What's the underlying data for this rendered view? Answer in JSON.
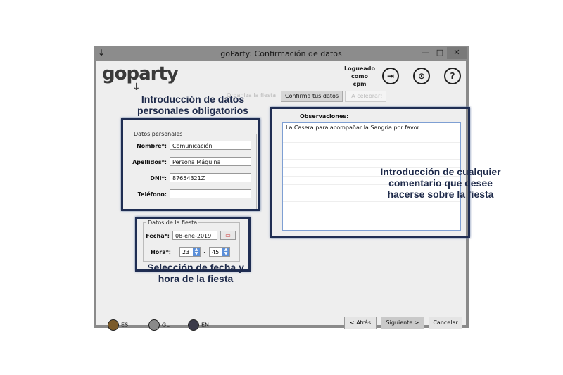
{
  "window": {
    "title": "goParty: Confirmación de datos",
    "menu_icon": "↓",
    "min": "—",
    "max": "□",
    "close": "✕"
  },
  "app": {
    "logo": "goparty",
    "logo_arrow": "↓"
  },
  "user": {
    "line1": "Logueado",
    "line2": "como",
    "line3": "cpm"
  },
  "header_icons": {
    "logout": "⇥",
    "cart": "⊙",
    "help": "?"
  },
  "tabs": [
    {
      "label": "Organiza la fiesta"
    },
    {
      "label": "Confirma tus datos"
    },
    {
      "label": "¡A celebrar!"
    }
  ],
  "datos_personales": {
    "legend": "Datos personales",
    "nombre_label": "Nombre*:",
    "nombre_value": "Comunicación",
    "apellidos_label": "Apellidos*:",
    "apellidos_value": "Persona Máquina",
    "dni_label": "DNI*:",
    "dni_value": "87654321Z",
    "telefono_label": "Teléfono:",
    "telefono_value": ""
  },
  "datos_fiesta": {
    "legend": "Datos de la fiesta",
    "fecha_label": "Fecha*:",
    "fecha_value": "08-ene-2019",
    "hora_label": "Hora*:",
    "hora_value": "23",
    "minuto_value": "45",
    "separator": ":"
  },
  "observaciones": {
    "label": "Observaciones:",
    "value": "La Casera para acompañar la Sangría por favor"
  },
  "annotations": {
    "personal_l1": "Introducción de datos",
    "personal_l2": "personales obligatorios",
    "fecha_l1": "Selección de fecha y",
    "fecha_l2": "hora de la fiesta",
    "obs_l1": "Introducción de cualquier",
    "obs_l2": "comentario que desee",
    "obs_l3": "hacerse sobre la fiesta"
  },
  "languages": [
    {
      "code": "ES"
    },
    {
      "code": "GL"
    },
    {
      "code": "EN"
    }
  ],
  "buttons": {
    "back": "< Atrás",
    "next": "Siguiente >",
    "cancel": "Cancelar"
  }
}
